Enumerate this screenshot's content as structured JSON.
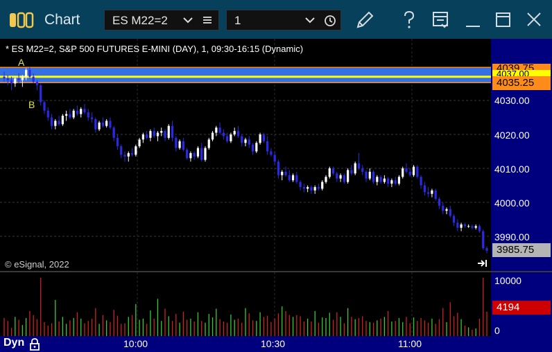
{
  "window": {
    "title": "Chart",
    "symbol_value": "ES M22=2",
    "interval_value": "1"
  },
  "chart": {
    "title_line": "* ES M22=2, S&P 500 FUTURES E-MINI (DAY), 1, 09:30-16:15 (Dynamic)",
    "copyright": "© eSignal, 2022",
    "marker_a": "A",
    "marker_b": "B",
    "price_labels": [
      "4030.00",
      "4020.00",
      "4010.00",
      "4000.00",
      "3990.00"
    ],
    "top_tags": [
      "4039.75",
      "4037.00"
    ],
    "tag_orange": "4035.25",
    "tag_last": "3985.75",
    "volume_labels": [
      "10000",
      "0"
    ],
    "volume_tag": "4194",
    "time_labels": [
      "10:00",
      "10:30",
      "11:00"
    ],
    "dyn_label": "Dyn"
  },
  "colors": {
    "titlebar": "#07405a",
    "axis_bg": "#00007f",
    "up_candle": "#ffffff",
    "down_candle": "#2a2ae6",
    "line_yellow": "#ffff00",
    "band_blue": "#3b7bff",
    "tag_orange": "#ff8c1a",
    "tag_red": "#cc0000",
    "vol_up": "#33cc33",
    "vol_down": "#cc2222"
  },
  "chart_data": {
    "type": "candlestick",
    "ylim": [
      3983,
      4041
    ],
    "ohlc": [
      [
        4037.0,
        4038.5,
        4035.5,
        4036.5
      ],
      [
        4036.5,
        4037.5,
        4034.5,
        4036.0
      ],
      [
        4036.0,
        4037.0,
        4033.0,
        4035.0
      ],
      [
        4035.0,
        4037.0,
        4034.0,
        4036.5
      ],
      [
        4036.5,
        4038.0,
        4035.0,
        4036.0
      ],
      [
        4036.0,
        4037.5,
        4034.0,
        4037.0
      ],
      [
        4037.0,
        4039.5,
        4036.0,
        4039.0
      ],
      [
        4039.0,
        4039.75,
        4036.5,
        4037.0
      ],
      [
        4037.0,
        4038.0,
        4035.0,
        4035.5
      ],
      [
        4035.5,
        4036.0,
        4033.0,
        4034.5
      ],
      [
        4034.5,
        4035.0,
        4028.5,
        4029.5
      ],
      [
        4029.5,
        4030.0,
        4026.0,
        4027.0
      ],
      [
        4027.0,
        4028.0,
        4024.0,
        4025.0
      ],
      [
        4025.0,
        4026.0,
        4021.5,
        4022.5
      ],
      [
        4022.5,
        4024.5,
        4021.5,
        4024.0
      ],
      [
        4024.0,
        4025.5,
        4022.5,
        4023.0
      ],
      [
        4023.0,
        4026.0,
        4022.5,
        4025.5
      ],
      [
        4025.5,
        4027.0,
        4024.0,
        4026.0
      ],
      [
        4026.0,
        4027.5,
        4024.5,
        4025.0
      ],
      [
        4025.0,
        4027.5,
        4024.5,
        4027.0
      ],
      [
        4027.0,
        4028.5,
        4025.5,
        4026.0
      ],
      [
        4026.0,
        4028.0,
        4025.0,
        4027.5
      ],
      [
        4027.5,
        4029.0,
        4026.0,
        4026.5
      ],
      [
        4026.5,
        4027.5,
        4024.0,
        4025.0
      ],
      [
        4025.0,
        4026.5,
        4023.5,
        4024.5
      ],
      [
        4024.5,
        4025.0,
        4020.5,
        4021.5
      ],
      [
        4021.5,
        4024.0,
        4021.0,
        4023.5
      ],
      [
        4023.5,
        4025.0,
        4022.0,
        4022.5
      ],
      [
        4022.5,
        4024.5,
        4022.0,
        4024.0
      ],
      [
        4024.0,
        4025.0,
        4021.5,
        4022.0
      ],
      [
        4022.0,
        4022.5,
        4018.0,
        4019.0
      ],
      [
        4019.0,
        4020.0,
        4015.5,
        4016.5
      ],
      [
        4016.5,
        4017.0,
        4013.0,
        4014.0
      ],
      [
        4014.0,
        4015.0,
        4012.0,
        4013.5
      ],
      [
        4013.5,
        4015.0,
        4012.0,
        4014.5
      ],
      [
        4014.5,
        4016.0,
        4013.5,
        4014.0
      ],
      [
        4014.0,
        4017.0,
        4013.5,
        4016.5
      ],
      [
        4016.5,
        4019.0,
        4016.0,
        4018.5
      ],
      [
        4018.5,
        4020.5,
        4017.5,
        4020.0
      ],
      [
        4020.0,
        4021.0,
        4018.5,
        4019.0
      ],
      [
        4019.0,
        4021.5,
        4018.0,
        4021.0
      ],
      [
        4021.0,
        4022.0,
        4019.0,
        4019.5
      ],
      [
        4019.5,
        4021.0,
        4018.0,
        4020.5
      ],
      [
        4020.5,
        4022.0,
        4019.5,
        4021.0
      ],
      [
        4021.0,
        4021.5,
        4018.0,
        4019.0
      ],
      [
        4019.0,
        4023.0,
        4018.5,
        4022.5
      ],
      [
        4022.5,
        4024.0,
        4018.0,
        4019.0
      ],
      [
        4019.0,
        4019.5,
        4015.0,
        4016.0
      ],
      [
        4016.0,
        4018.5,
        4015.5,
        4018.0
      ],
      [
        4018.0,
        4019.0,
        4015.0,
        4015.5
      ],
      [
        4015.5,
        4016.0,
        4012.5,
        4013.0
      ],
      [
        4013.0,
        4015.0,
        4012.0,
        4014.5
      ],
      [
        4014.5,
        4015.0,
        4012.5,
        4013.5
      ],
      [
        4013.5,
        4016.5,
        4013.0,
        4016.0
      ],
      [
        4016.0,
        4017.5,
        4012.0,
        4012.5
      ],
      [
        4012.5,
        4016.5,
        4012.0,
        4016.0
      ],
      [
        4016.0,
        4019.0,
        4015.5,
        4018.5
      ],
      [
        4018.5,
        4021.0,
        4018.0,
        4020.5
      ],
      [
        4020.5,
        4022.5,
        4019.5,
        4022.0
      ],
      [
        4022.0,
        4023.5,
        4020.0,
        4020.5
      ],
      [
        4020.5,
        4021.5,
        4018.5,
        4019.5
      ],
      [
        4019.5,
        4020.5,
        4017.5,
        4018.0
      ],
      [
        4018.0,
        4020.5,
        4017.5,
        4020.0
      ],
      [
        4020.0,
        4022.0,
        4019.5,
        4021.0
      ],
      [
        4021.0,
        4022.5,
        4019.0,
        4019.5
      ],
      [
        4019.5,
        4020.0,
        4016.5,
        4017.5
      ],
      [
        4017.5,
        4019.0,
        4016.5,
        4018.5
      ],
      [
        4018.5,
        4019.5,
        4016.0,
        4017.0
      ],
      [
        4017.0,
        4017.5,
        4014.0,
        4015.0
      ],
      [
        4015.0,
        4018.0,
        4014.5,
        4017.5
      ],
      [
        4017.5,
        4020.5,
        4017.0,
        4020.0
      ],
      [
        4020.0,
        4020.5,
        4017.5,
        4018.0
      ],
      [
        4018.0,
        4019.5,
        4014.0,
        4015.0
      ],
      [
        4015.0,
        4016.0,
        4013.5,
        4014.0
      ],
      [
        4014.0,
        4015.0,
        4011.0,
        4012.0
      ],
      [
        4012.0,
        4012.5,
        4007.0,
        4008.0
      ],
      [
        4008.0,
        4009.5,
        4006.5,
        4009.0
      ],
      [
        4009.0,
        4010.5,
        4007.5,
        4008.0
      ],
      [
        4008.0,
        4009.5,
        4006.0,
        4006.5
      ],
      [
        4006.5,
        4008.5,
        4006.0,
        4008.0
      ],
      [
        4008.0,
        4009.0,
        4005.5,
        4006.0
      ],
      [
        4006.0,
        4006.5,
        4003.5,
        4004.5
      ],
      [
        4004.5,
        4005.5,
        4003.0,
        4004.0
      ],
      [
        4004.0,
        4005.0,
        4003.0,
        4004.5
      ],
      [
        4004.5,
        4005.0,
        4002.5,
        4003.5
      ],
      [
        4003.5,
        4005.0,
        4002.5,
        4004.5
      ],
      [
        4004.5,
        4005.5,
        4003.5,
        4004.0
      ],
      [
        4004.0,
        4006.5,
        4003.5,
        4006.0
      ],
      [
        4006.0,
        4008.0,
        4005.5,
        4007.5
      ],
      [
        4007.5,
        4010.5,
        4007.0,
        4010.0
      ],
      [
        4010.0,
        4010.5,
        4008.0,
        4008.5
      ],
      [
        4008.5,
        4009.0,
        4006.0,
        4007.0
      ],
      [
        4007.0,
        4008.5,
        4006.0,
        4008.0
      ],
      [
        4008.0,
        4008.5,
        4005.5,
        4006.0
      ],
      [
        4006.0,
        4010.0,
        4005.5,
        4009.5
      ],
      [
        4009.5,
        4011.0,
        4008.0,
        4008.5
      ],
      [
        4008.5,
        4012.0,
        4008.0,
        4011.5
      ],
      [
        4011.5,
        4014.5,
        4009.5,
        4010.0
      ],
      [
        4010.0,
        4011.0,
        4008.0,
        4009.0
      ],
      [
        4009.0,
        4009.5,
        4006.0,
        4007.0
      ],
      [
        4007.0,
        4010.0,
        4006.5,
        4009.0
      ],
      [
        4009.0,
        4009.5,
        4005.5,
        4006.0
      ],
      [
        4006.0,
        4008.0,
        4005.0,
        4007.5
      ],
      [
        4007.5,
        4008.0,
        4005.5,
        4006.0
      ],
      [
        4006.0,
        4008.0,
        4005.5,
        4007.0
      ],
      [
        4007.0,
        4007.5,
        4004.5,
        4005.5
      ],
      [
        4005.5,
        4007.0,
        4004.5,
        4006.5
      ],
      [
        4006.5,
        4007.5,
        4005.0,
        4005.5
      ],
      [
        4005.5,
        4008.0,
        4005.0,
        4007.5
      ],
      [
        4007.5,
        4010.5,
        4007.0,
        4010.0
      ],
      [
        4010.0,
        4011.5,
        4008.5,
        4009.0
      ],
      [
        4009.0,
        4010.0,
        4007.5,
        4008.0
      ],
      [
        4008.0,
        4011.0,
        4007.5,
        4010.5
      ],
      [
        4010.5,
        4011.0,
        4007.0,
        4007.5
      ],
      [
        4007.5,
        4008.0,
        4004.0,
        4005.0
      ],
      [
        4005.0,
        4006.0,
        4002.0,
        4003.0
      ],
      [
        4003.0,
        4004.5,
        4001.5,
        4002.5
      ],
      [
        4002.5,
        4004.0,
        4001.5,
        4003.5
      ],
      [
        4003.5,
        4004.0,
        4000.5,
        4001.0
      ],
      [
        4001.0,
        4001.5,
        3998.0,
        3999.0
      ],
      [
        3999.0,
        4000.0,
        3996.5,
        3997.5
      ],
      [
        3997.5,
        3998.5,
        3996.5,
        3998.0
      ],
      [
        3998.0,
        3999.0,
        3995.5,
        3996.0
      ],
      [
        3996.0,
        3996.5,
        3993.0,
        3994.0
      ],
      [
        3994.0,
        3995.0,
        3991.5,
        3992.5
      ],
      [
        3992.5,
        3994.0,
        3991.5,
        3993.5
      ],
      [
        3993.5,
        3994.0,
        3992.5,
        3993.0
      ],
      [
        3993.0,
        3993.5,
        3992.5,
        3993.0
      ],
      [
        3993.0,
        3993.5,
        3992.0,
        3992.5
      ],
      [
        3992.5,
        3993.5,
        3992.0,
        3993.0
      ],
      [
        3993.0,
        3993.5,
        3991.0,
        3991.5
      ],
      [
        3991.5,
        3992.0,
        3986.0,
        3986.5
      ],
      [
        3986.5,
        3987.0,
        3985.0,
        3985.75
      ]
    ],
    "volume_max": 10000,
    "volumes": [
      3100,
      2600,
      1400,
      3300,
      2800,
      1900,
      3100,
      4300,
      3600,
      2900,
      10000,
      2400,
      1800,
      2200,
      6200,
      2500,
      3300,
      2100,
      2700,
      3100,
      4100,
      3000,
      2200,
      2600,
      3000,
      4800,
      2100,
      3600,
      2700,
      2400,
      4500,
      3500,
      2100,
      2200,
      3300,
      3600,
      5500,
      2800,
      3000,
      2100,
      4400,
      3000,
      6400,
      2600,
      4700,
      3400,
      2600,
      3800,
      2300,
      4200,
      2800,
      3000,
      2500,
      4100,
      2600,
      2300,
      3800,
      3200,
      4700,
      2900,
      2500,
      2300,
      3700,
      2800,
      3000,
      2300,
      4800,
      3900,
      2700,
      2600,
      4100,
      3300,
      3500,
      2400,
      3000,
      3900,
      5100,
      4300,
      3600,
      3300,
      3600,
      3400,
      2500,
      3000,
      2500,
      4300,
      2300,
      3200,
      3100,
      4000,
      2800,
      4100,
      3300,
      2200,
      4800,
      3300,
      2900,
      3100,
      3400,
      2600,
      2400,
      2300,
      2700,
      3000,
      3300,
      4300,
      2500,
      2600,
      3100,
      2400,
      3300,
      2200,
      3200,
      2600,
      3100,
      2700,
      2300,
      3000,
      2100,
      2900,
      4800,
      2400,
      5800,
      3400,
      4000,
      2900,
      1800,
      1500,
      1100,
      1300,
      3000,
      10000,
      4194
    ]
  }
}
